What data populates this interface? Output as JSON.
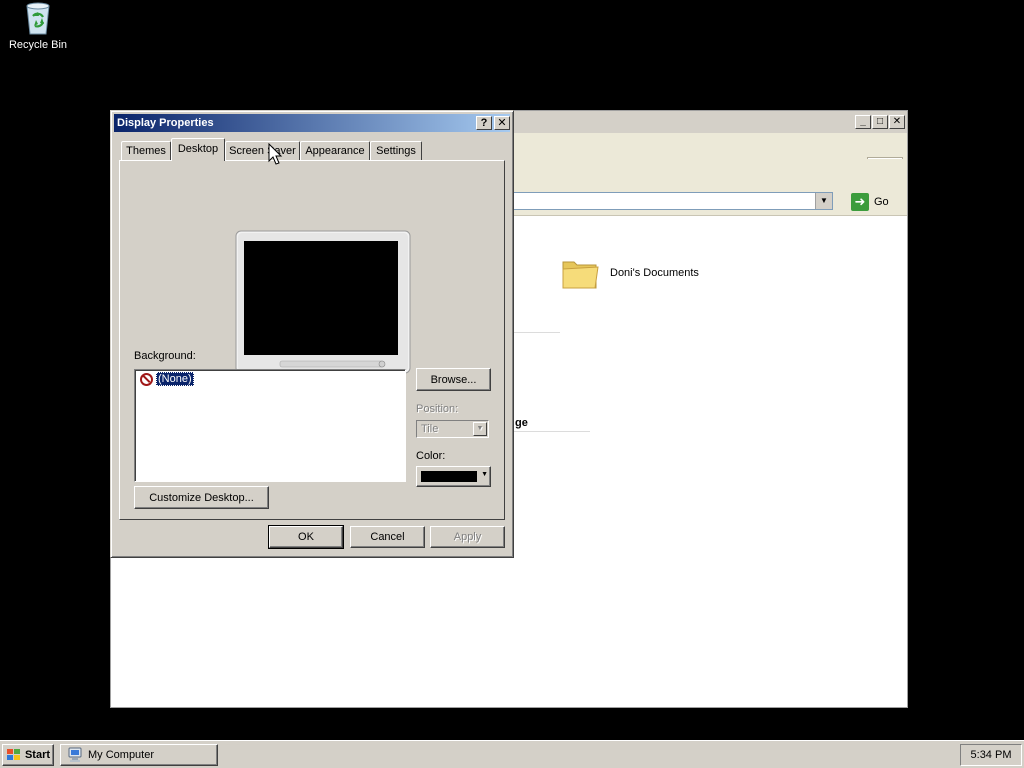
{
  "desktop": {
    "recycle_bin_label": "Recycle Bin"
  },
  "explorer": {
    "address": {
      "go_label": "Go"
    },
    "folder_name": "Doni's Documents",
    "partial_heading": "ge"
  },
  "dialog": {
    "title": "Display Properties",
    "help_glyph": "?",
    "close_glyph": "✕",
    "tabs": [
      {
        "label": "Themes"
      },
      {
        "label": "Desktop"
      },
      {
        "label": "Screen Saver"
      },
      {
        "label": "Appearance"
      },
      {
        "label": "Settings"
      }
    ],
    "active_tab": "Desktop",
    "background_label": "Background:",
    "background_items": [
      {
        "label": "(None)",
        "icon": "none-icon",
        "selected": true
      }
    ],
    "browse_label": "Browse...",
    "position_label": "Position:",
    "position_value": "Tile",
    "color_label": "Color:",
    "color_value": "#000000",
    "customize_label": "Customize Desktop...",
    "ok_label": "OK",
    "cancel_label": "Cancel",
    "apply_label": "Apply"
  },
  "taskbar": {
    "start_label": "Start",
    "tasks": [
      {
        "label": "My Computer",
        "icon": "my-computer-icon"
      }
    ],
    "clock": "5:34 PM"
  },
  "colors": {
    "desktop_background": "#000000",
    "title_active_start": "#0a246a",
    "title_active_end": "#a6caf0",
    "face": "#d4d0c8"
  }
}
